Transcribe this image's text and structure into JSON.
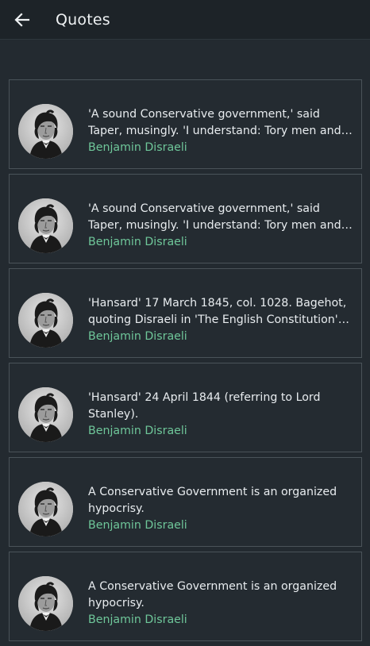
{
  "appbar": {
    "title": "Quotes",
    "back_icon": "arrow-left-icon"
  },
  "colors": {
    "background": "#232a30",
    "appbar": "#1d2328",
    "author": "#6fc79a",
    "card_border": "#4a5359"
  },
  "quotes": [
    {
      "text": "'A sound Conservative government,' said Taper, musingly. 'I understand: Tory men and Whig…",
      "author": "Benjamin Disraeli"
    },
    {
      "text": "'A sound Conservative government,' said Taper, musingly. 'I understand: Tory men and Whig…",
      "author": "Benjamin Disraeli"
    },
    {
      "text": "'Hansard' 17 March 1845, col. 1028. Bagehot, quoting Disraeli in 'The English Constitution' (186…",
      "author": "Benjamin Disraeli"
    },
    {
      "text": "'Hansard' 24 April 1844 (referring to Lord Stanley).",
      "author": "Benjamin Disraeli"
    },
    {
      "text": "A Conservative Government is an organized hypocrisy.",
      "author": "Benjamin Disraeli"
    },
    {
      "text": "A Conservative Government is an organized hypocrisy.",
      "author": "Benjamin Disraeli"
    }
  ]
}
